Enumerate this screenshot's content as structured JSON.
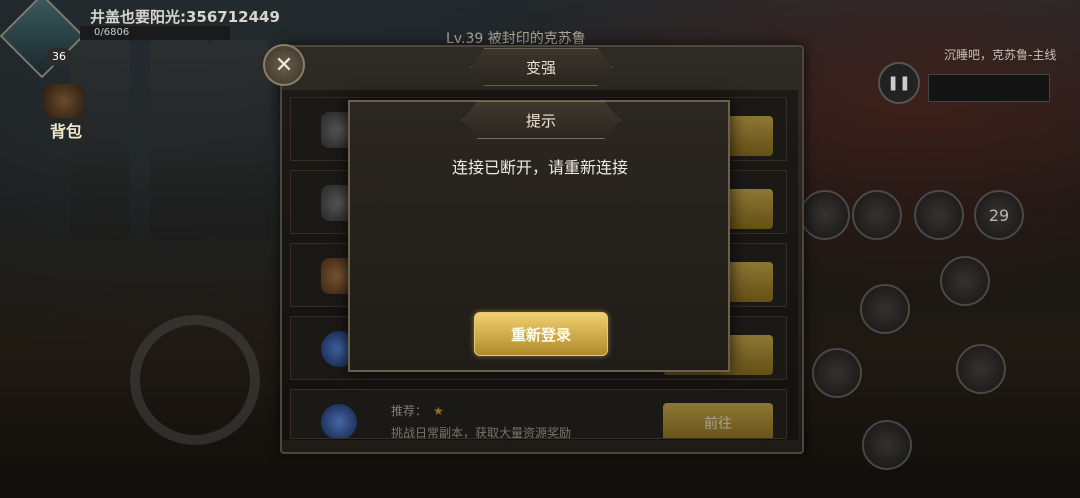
{
  "hud": {
    "player_name": "井盖也要阳光:356712449",
    "exp_text": "0/6806",
    "level": "36",
    "bag_label": "背包",
    "stage_title": "Lv.39 被封印的克苏鲁",
    "boss_text": "沉睡吧，克苏鲁-主线",
    "pause_icon": "pause-icon"
  },
  "panel": {
    "tab_title": "变强",
    "close_icon": "close-icon",
    "rows": [
      {
        "icon": "book-icon",
        "recommend_label": "",
        "description": "",
        "button_label": "往"
      },
      {
        "icon": "spellbook-icon",
        "recommend_label": "",
        "description": "",
        "button_label": "前往"
      },
      {
        "icon": "bag-icon",
        "recommend_label": "",
        "description": "",
        "button_label": "往"
      },
      {
        "icon": "portal-icon",
        "recommend_label": "",
        "description": "",
        "button_label": "往"
      },
      {
        "icon": "portal-icon",
        "recommend_label": "推荐：",
        "stars": "★",
        "description": "挑战日常副本，获取大量资源奖励",
        "button_label": "前往"
      }
    ]
  },
  "dialog": {
    "title": "提示",
    "message": "连接已断开，请重新连接",
    "button_label": "重新登录"
  },
  "skills": {
    "cooldown_value": "29"
  }
}
